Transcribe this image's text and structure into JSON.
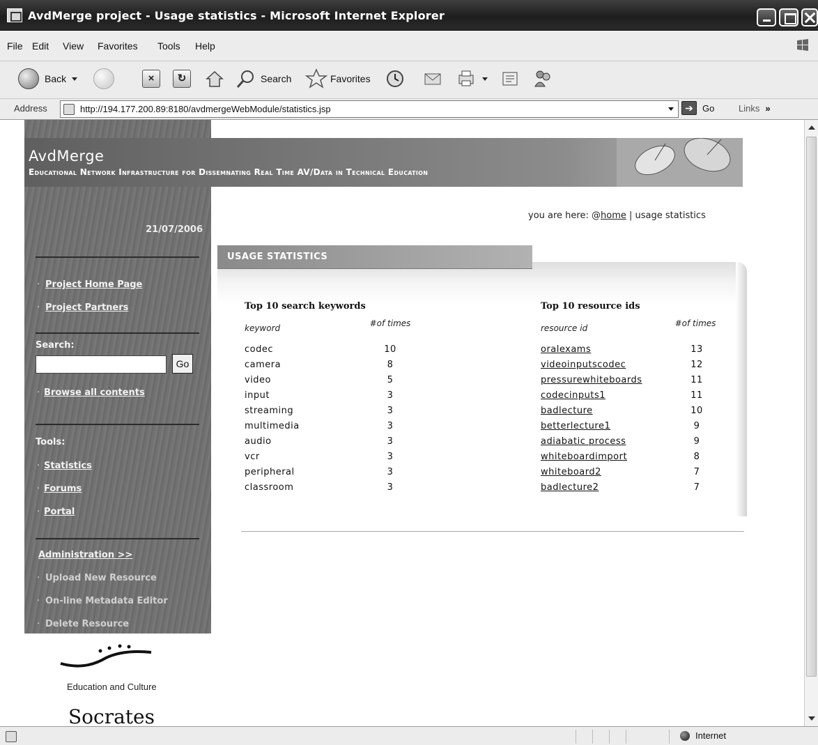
{
  "window": {
    "title": "AvdMerge project - Usage statistics - Microsoft Internet Explorer"
  },
  "menu": [
    "File",
    "Edit",
    "View",
    "Favorites",
    "Tools",
    "Help"
  ],
  "toolbar": {
    "back": "Back",
    "search": "Search",
    "favorites": "Favorites"
  },
  "address": {
    "label": "Address",
    "url": "http://194.177.200.89:8180/avdmergeWebModule/statistics.jsp",
    "go": "Go",
    "links": "Links"
  },
  "banner": {
    "brand": "AvdMerge",
    "tagline": "Educational Network Infrastructure for Dissemnating Real Time AV/Data in Technical Education"
  },
  "sidebar": {
    "date": "21/07/2006",
    "links": [
      "Project Home Page",
      "Project Partners"
    ],
    "search_label": "Search:",
    "search_value": "",
    "search_go": "Go",
    "browse": "Browse all contents",
    "tools_label": "Tools:",
    "tools": [
      "Statistics",
      "Forums",
      "Portal"
    ],
    "admin": "Administration >>",
    "admin_items": [
      "Upload New Resource",
      "On-line Metadata Editor",
      "Delete Resource"
    ]
  },
  "breadcrumb": {
    "prefix": "you are here:",
    "home": "home",
    "sep": "|",
    "current": "usage statistics"
  },
  "section_title": "USAGE STATISTICS",
  "keywords_table": {
    "title": "Top 10 search keywords",
    "col1": "keyword",
    "col2": "#of times",
    "rows": [
      {
        "name": "codec",
        "count": "10"
      },
      {
        "name": "camera",
        "count": "8"
      },
      {
        "name": "video",
        "count": "5"
      },
      {
        "name": "input",
        "count": "3"
      },
      {
        "name": "streaming",
        "count": "3"
      },
      {
        "name": "multimedia",
        "count": "3"
      },
      {
        "name": "audio",
        "count": "3"
      },
      {
        "name": "vcr",
        "count": "3"
      },
      {
        "name": "peripheral",
        "count": "3"
      },
      {
        "name": "classroom",
        "count": "3"
      }
    ]
  },
  "resources_table": {
    "title": "Top 10 resource ids",
    "col1": "resource id",
    "col2": "#of times",
    "rows": [
      {
        "name": "oralexams",
        "count": "13"
      },
      {
        "name": "videoinputscodec",
        "count": "12"
      },
      {
        "name": "pressurewhiteboards",
        "count": "11"
      },
      {
        "name": "codecinputs1",
        "count": "11"
      },
      {
        "name": "badlecture",
        "count": "10"
      },
      {
        "name": "betterlecture1",
        "count": "9"
      },
      {
        "name": "adiabatic process",
        "count": "9"
      },
      {
        "name": "whiteboardimport",
        "count": "8"
      },
      {
        "name": "whiteboard2",
        "count": "7"
      },
      {
        "name": "badlecture2",
        "count": "7"
      }
    ]
  },
  "footer": {
    "eu_text": "Education and Culture",
    "programme": "Socrates"
  },
  "status": {
    "zone": "Internet"
  }
}
